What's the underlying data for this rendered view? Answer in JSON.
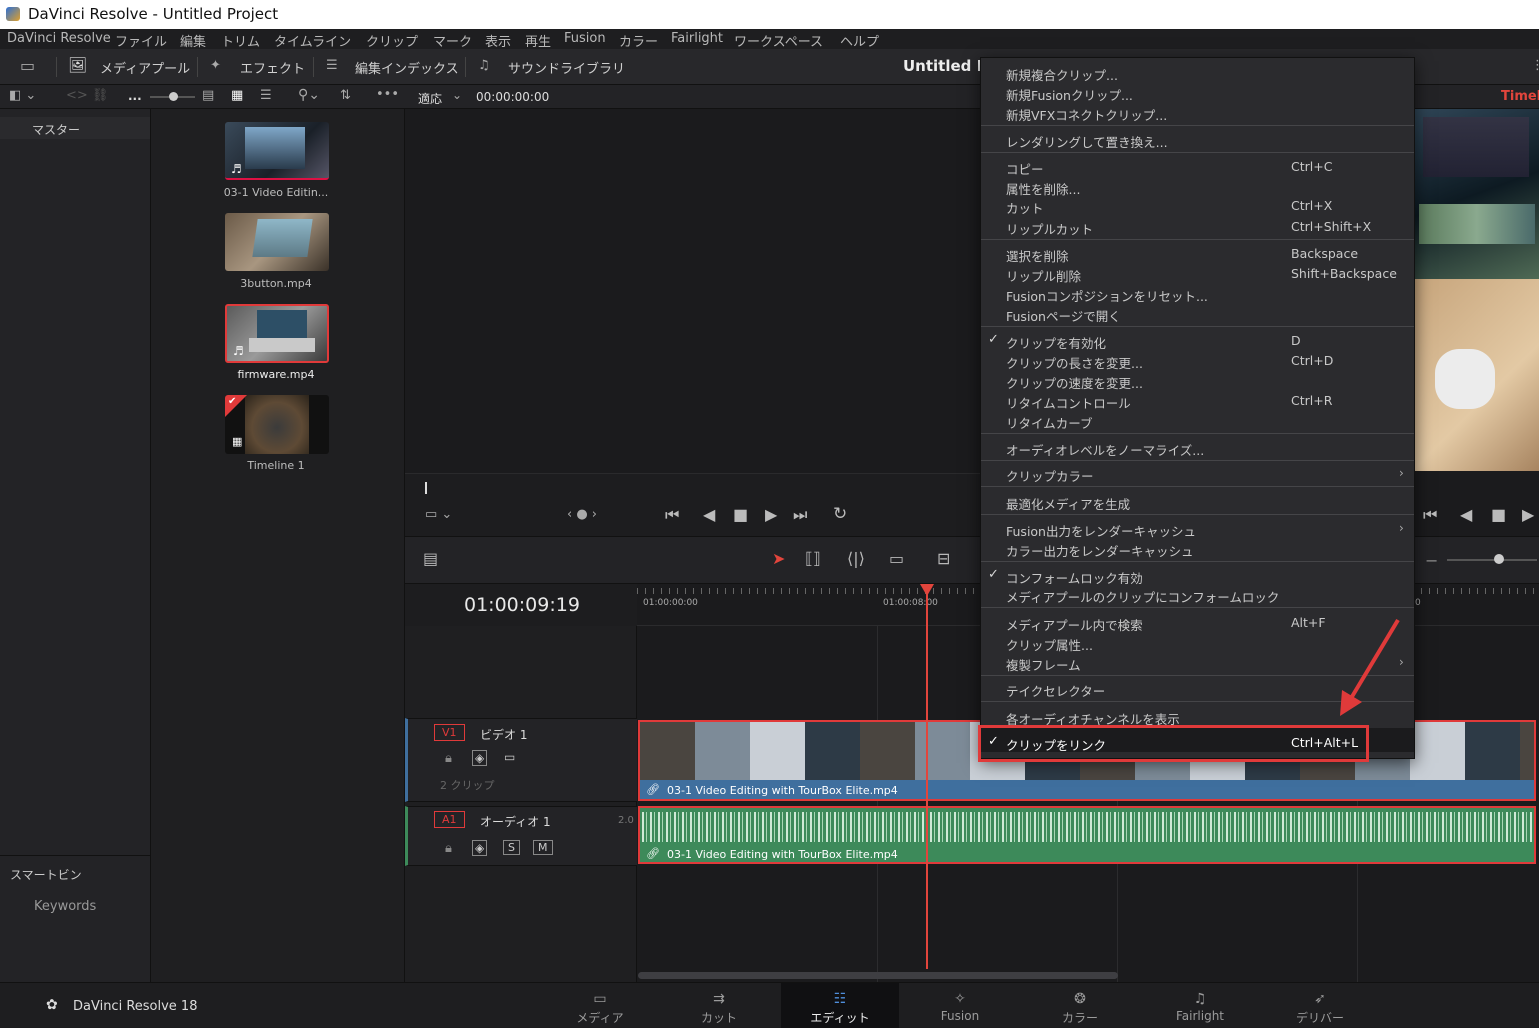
{
  "window": {
    "title": "DaVinci Resolve - Untitled Project"
  },
  "menubar": [
    "DaVinci Resolve",
    "ファイル",
    "編集",
    "トリム",
    "タイムライン",
    "クリップ",
    "マーク",
    "表示",
    "再生",
    "Fusion",
    "カラー",
    "Fairlight",
    "ワークスペース",
    "ヘルプ"
  ],
  "toolbar": {
    "media_pool": "メディアプール",
    "effects": "エフェクト",
    "edit_index": "編集インデックス",
    "sound_library": "サウンドライブラリ",
    "project_title": "Untitled Pr",
    "timeline_label": "Timeli"
  },
  "subbar": {
    "more": "...",
    "fit": "適応",
    "timecode": "00:00:00:00"
  },
  "leftpanel": {
    "master": "マスター",
    "smart_bins": "スマートビン",
    "keywords": "Keywords"
  },
  "clips": [
    {
      "name": "03-1 Video Editin..."
    },
    {
      "name": "3button.mp4"
    },
    {
      "name": "firmware.mp4"
    },
    {
      "name": "Timeline 1"
    }
  ],
  "timeline": {
    "timecode": "01:00:09:19",
    "ruler_ticks": [
      "01:00:00:00",
      "01:00:08:00",
      "0"
    ],
    "video_track": {
      "id": "V1",
      "name": "ビデオ 1",
      "clips_count": "2 クリップ",
      "clip_name": "03-1 Video Editing with TourBox Elite.mp4"
    },
    "audio_track": {
      "id": "A1",
      "name": "オーディオ 1",
      "channels": "2.0",
      "solo": "S",
      "mute": "M",
      "clip_name": "03-1 Video Editing with TourBox Elite.mp4"
    }
  },
  "context_menu": {
    "items": [
      {
        "label": "新規複合クリップ...",
        "shortcut": ""
      },
      {
        "label": "新規Fusionクリップ...",
        "shortcut": ""
      },
      {
        "label": "新規VFXコネクトクリップ...",
        "shortcut": ""
      },
      {
        "label": "レンダリングして置き換え...",
        "shortcut": ""
      },
      {
        "label": "コピー",
        "shortcut": "Ctrl+C"
      },
      {
        "label": "属性を削除...",
        "shortcut": ""
      },
      {
        "label": "カット",
        "shortcut": "Ctrl+X"
      },
      {
        "label": "リップルカット",
        "shortcut": "Ctrl+Shift+X"
      },
      {
        "label": "選択を削除",
        "shortcut": "Backspace"
      },
      {
        "label": "リップル削除",
        "shortcut": "Shift+Backspace"
      },
      {
        "label": "Fusionコンポジションをリセット...",
        "shortcut": ""
      },
      {
        "label": "Fusionページで開く",
        "shortcut": ""
      },
      {
        "label": "クリップを有効化",
        "shortcut": "D"
      },
      {
        "label": "クリップの長さを変更...",
        "shortcut": "Ctrl+D"
      },
      {
        "label": "クリップの速度を変更...",
        "shortcut": ""
      },
      {
        "label": "リタイムコントロール",
        "shortcut": "Ctrl+R"
      },
      {
        "label": "リタイムカーブ",
        "shortcut": ""
      },
      {
        "label": "オーディオレベルをノーマライズ...",
        "shortcut": ""
      },
      {
        "label": "クリップカラー",
        "shortcut": ""
      },
      {
        "label": "最適化メディアを生成",
        "shortcut": ""
      },
      {
        "label": "Fusion出力をレンダーキャッシュ",
        "shortcut": ""
      },
      {
        "label": "カラー出力をレンダーキャッシュ",
        "shortcut": ""
      },
      {
        "label": "コンフォームロック有効",
        "shortcut": ""
      },
      {
        "label": "メディアプールのクリップにコンフォームロック",
        "shortcut": ""
      },
      {
        "label": "メディアプール内で検索",
        "shortcut": "Alt+F"
      },
      {
        "label": "クリップ属性...",
        "shortcut": ""
      },
      {
        "label": "複製フレーム",
        "shortcut": ""
      },
      {
        "label": "テイクセレクター",
        "shortcut": ""
      },
      {
        "label": "各オーディオチャンネルを表示",
        "shortcut": ""
      },
      {
        "label": "クリップをリンク",
        "shortcut": "Ctrl+Alt+L"
      }
    ],
    "checked": [
      "クリップを有効化",
      "コンフォームロック有効",
      "クリップをリンク"
    ],
    "highlighted": "クリップをリンク"
  },
  "pagebar": {
    "brand": "DaVinci Resolve 18",
    "pages": [
      "メディア",
      "カット",
      "エディット",
      "Fusion",
      "カラー",
      "Fairlight",
      "デリバー"
    ],
    "active": "エディット"
  },
  "colors": {
    "accent_red": "#e03a3a",
    "video_clip": "#3f6f9e",
    "audio_clip": "#3d8a5a",
    "playhead": "#e2453c"
  }
}
